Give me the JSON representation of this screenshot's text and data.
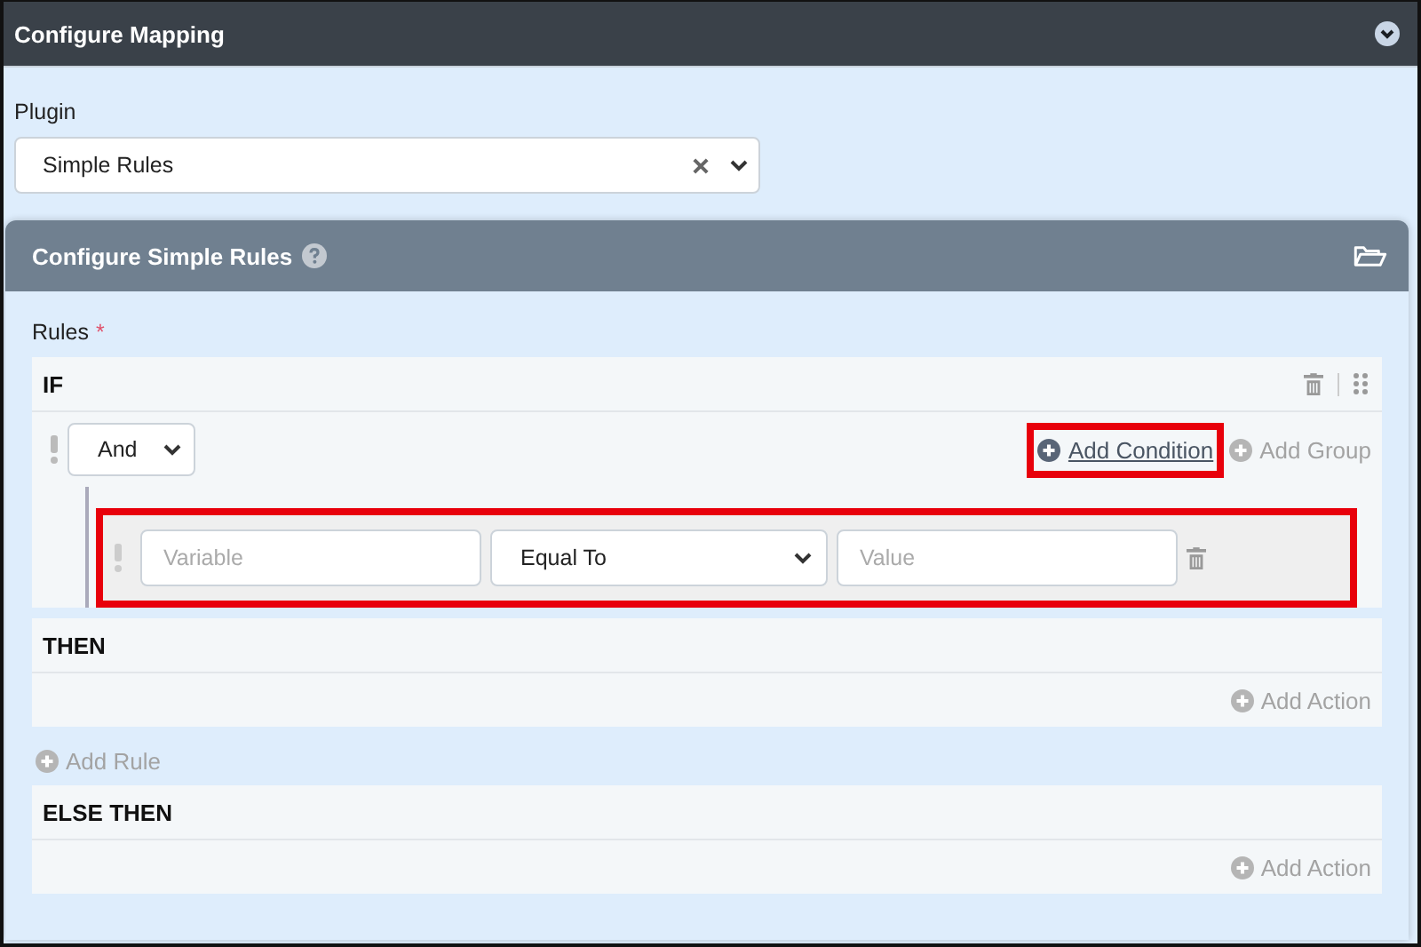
{
  "header": {
    "title": "Configure Mapping"
  },
  "plugin": {
    "label": "Plugin",
    "value": "Simple Rules"
  },
  "panel": {
    "title": "Configure Simple Rules"
  },
  "rules": {
    "label": "Rules",
    "required_mark": "*",
    "if_block": {
      "title": "IF",
      "operator": "And",
      "add_condition": "Add Condition",
      "add_condition_highlighted": true,
      "add_group": "Add Group",
      "conditions": [
        {
          "variable_placeholder": "Variable",
          "comparison": "Equal To",
          "value_placeholder": "Value",
          "highlighted": true
        }
      ]
    },
    "then_block": {
      "title": "THEN",
      "add_action": "Add Action"
    },
    "add_rule": "Add Rule",
    "else_block": {
      "title": "ELSE THEN",
      "add_action": "Add Action"
    }
  }
}
